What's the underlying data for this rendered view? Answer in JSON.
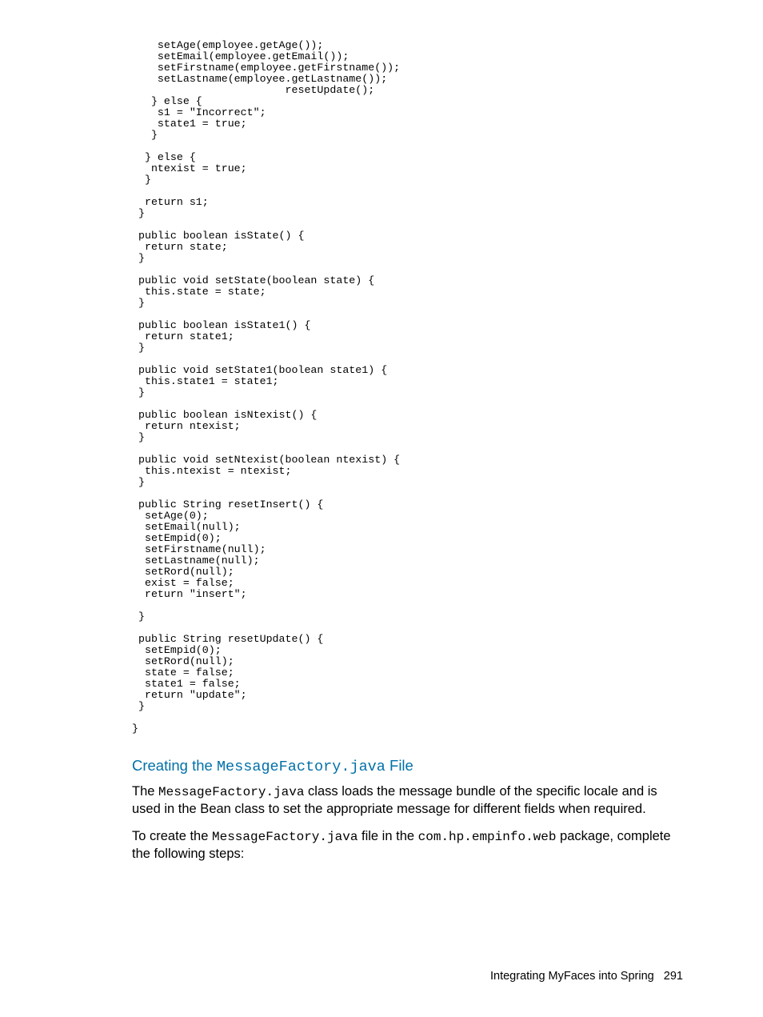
{
  "code_block": "    setAge(employee.getAge());\n    setEmail(employee.getEmail());\n    setFirstname(employee.getFirstname());\n    setLastname(employee.getLastname());\n                        resetUpdate();\n   } else {\n    s1 = \"Incorrect\";\n    state1 = true;\n   }\n\n  } else {\n   ntexist = true;\n  }\n\n  return s1;\n }\n\n public boolean isState() {\n  return state;\n }\n\n public void setState(boolean state) {\n  this.state = state;\n }\n\n public boolean isState1() {\n  return state1;\n }\n\n public void setState1(boolean state1) {\n  this.state1 = state1;\n }\n\n public boolean isNtexist() {\n  return ntexist;\n }\n\n public void setNtexist(boolean ntexist) {\n  this.ntexist = ntexist;\n }\n\n public String resetInsert() {\n  setAge(0);\n  setEmail(null);\n  setEmpid(0);\n  setFirstname(null);\n  setLastname(null);\n  setRord(null);\n  exist = false;\n  return \"insert\";\n\n }\n\n public String resetUpdate() {\n  setEmpid(0);\n  setRord(null);\n  state = false;\n  state1 = false;\n  return \"update\";\n }\n\n}",
  "heading": {
    "prefix": "Creating the ",
    "mono": "MessageFactory.java",
    "suffix": " File"
  },
  "para1": {
    "t1": "The ",
    "m1": "MessageFactory.java",
    "t2": " class loads the message bundle of the specific locale and is used in the Bean class to set the appropriate message for different fields when required."
  },
  "para2": {
    "t1": "To create the ",
    "m1": "MessageFactory.java",
    "t2": " file in the ",
    "m2": "com.hp.empinfo.web",
    "t3": " package, complete the following steps:"
  },
  "footer": {
    "section": "Integrating MyFaces into Spring",
    "page": "291"
  }
}
